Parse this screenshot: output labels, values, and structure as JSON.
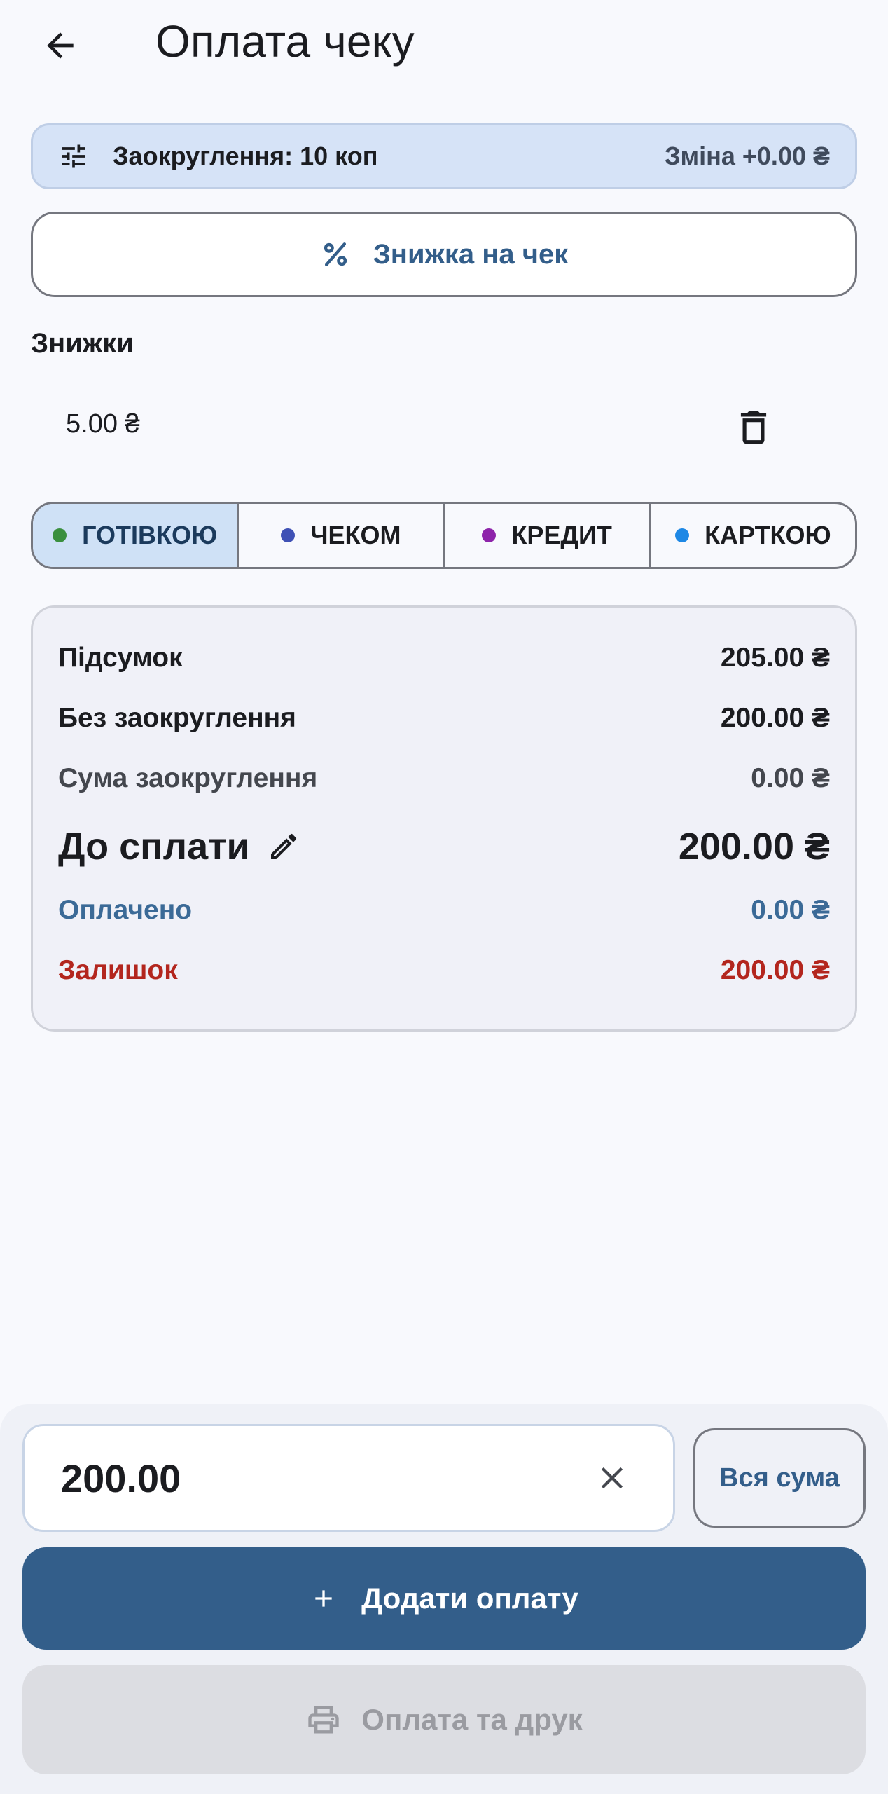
{
  "header": {
    "title": "Оплата чеку",
    "back_icon": "arrow-back-icon"
  },
  "rounding": {
    "label": "Заокруглення: 10 коп",
    "change": "Зміна +0.00 ₴",
    "icon": "tune-icon"
  },
  "discount_button": {
    "label": "Знижка на чек",
    "icon": "percent-icon"
  },
  "discounts": {
    "title": "Знижки",
    "items": [
      {
        "amount": "5.00 ₴",
        "delete_icon": "delete-icon"
      }
    ]
  },
  "payment_types": [
    {
      "label": "ГОТІВКОЮ",
      "dot_color": "#3a8f3e",
      "active": true
    },
    {
      "label": "ЧЕКОМ",
      "dot_color": "#3f51b5",
      "active": false
    },
    {
      "label": "КРЕДИТ",
      "dot_color": "#8e24aa",
      "active": false
    },
    {
      "label": "КАРТКОЮ",
      "dot_color": "#1e88e5",
      "active": false
    }
  ],
  "summary": {
    "subtotal_label": "Підсумок",
    "subtotal_value": "205.00 ₴",
    "no_rounding_label": "Без заокруглення",
    "no_rounding_value": "200.00 ₴",
    "rounding_sum_label": "Сума заокруглення",
    "rounding_sum_value": "0.00 ₴",
    "due_label": "До сплати",
    "due_value": "200.00 ₴",
    "paid_label": "Оплачено",
    "paid_value": "0.00 ₴",
    "rest_label": "Залишок",
    "rest_value": "200.00 ₴"
  },
  "payment_input": {
    "value": "200.00",
    "clear_icon": "close-icon",
    "all_sum_label": "Вся сума"
  },
  "actions": {
    "add_payment_label": "Додати оплату",
    "pay_print_label": "Оплата та друк"
  },
  "colors": {
    "primary": "#335e8a",
    "error": "#b3261e",
    "chip_bg": "#d6e3f7"
  }
}
